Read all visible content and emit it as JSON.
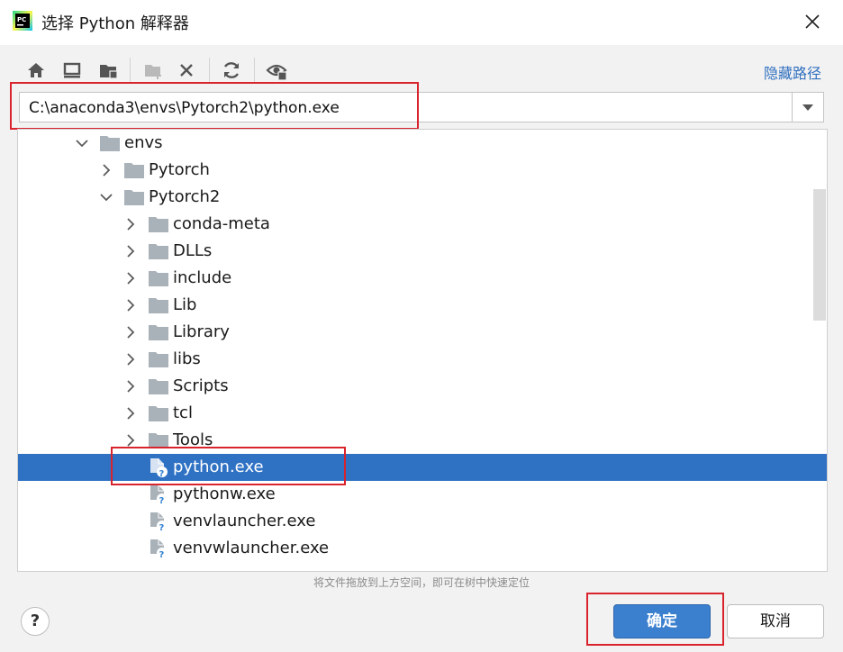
{
  "window": {
    "title": "选择 Python 解释器",
    "app_icon": "pycharm-icon",
    "close_icon": "close-icon"
  },
  "toolbar": {
    "buttons": [
      "home-icon",
      "desktop-icon",
      "project-folder-icon",
      "new-folder-icon",
      "delete-icon",
      "refresh-icon",
      "show-hidden-icon"
    ],
    "hide_path_label": "隐藏路径"
  },
  "path": {
    "value": "C:\\anaconda3\\envs\\Pytorch2\\python.exe"
  },
  "tree": {
    "nodes": [
      {
        "label": "envs",
        "type": "folder",
        "expanded": true
      },
      {
        "label": "Pytorch",
        "type": "folder",
        "expanded": false
      },
      {
        "label": "Pytorch2",
        "type": "folder",
        "expanded": true
      },
      {
        "label": "conda-meta",
        "type": "folder",
        "expanded": false
      },
      {
        "label": "DLLs",
        "type": "folder",
        "expanded": false
      },
      {
        "label": "include",
        "type": "folder",
        "expanded": false
      },
      {
        "label": "Lib",
        "type": "folder",
        "expanded": false
      },
      {
        "label": "Library",
        "type": "folder",
        "expanded": false
      },
      {
        "label": "libs",
        "type": "folder",
        "expanded": false
      },
      {
        "label": "Scripts",
        "type": "folder",
        "expanded": false
      },
      {
        "label": "tcl",
        "type": "folder",
        "expanded": false
      },
      {
        "label": "Tools",
        "type": "folder",
        "expanded": false
      },
      {
        "label": "python.exe",
        "type": "file",
        "selected": true
      },
      {
        "label": "pythonw.exe",
        "type": "file"
      },
      {
        "label": "venvlauncher.exe",
        "type": "file"
      },
      {
        "label": "venvwlauncher.exe",
        "type": "file"
      }
    ]
  },
  "hint": "将文件拖放到上方空间，即可在树中快速定位",
  "buttons": {
    "help": "?",
    "ok": "确定",
    "cancel": "取消"
  },
  "colors": {
    "selection": "#2f72c4",
    "accent": "#3b7fcf",
    "annotation": "#d9232d",
    "link": "#2f6fbf"
  }
}
